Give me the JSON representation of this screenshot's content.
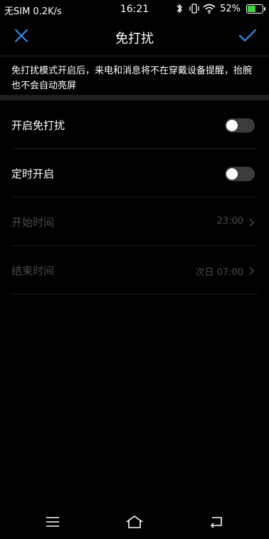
{
  "status_bar": {
    "carrier": "无SIM 0.2K/s",
    "time": "16:21",
    "battery_percent": "52%",
    "icons": [
      "bluetooth-icon",
      "vibrate-icon",
      "wifi-icon",
      "battery-icon"
    ],
    "battery_level": 0.52
  },
  "header": {
    "title": "免打扰",
    "close_icon": "close-icon",
    "confirm_icon": "check-icon",
    "accent_color": "#2f8ff0"
  },
  "notice": {
    "text": "免打扰模式开启后，来电和消息将不在穿戴设备提醒，抬腕也不会自动亮屏"
  },
  "settings": {
    "enable": {
      "label": "开启免打扰",
      "on": false
    },
    "scheduled": {
      "label": "定时开启",
      "on": false
    },
    "start_time": {
      "label": "开始时间",
      "value": "23:00"
    },
    "end_time": {
      "label": "结束时间",
      "value": "次日 07:00"
    }
  },
  "nav_bar": {
    "icons": [
      "menu-icon",
      "home-icon",
      "back-icon"
    ]
  }
}
